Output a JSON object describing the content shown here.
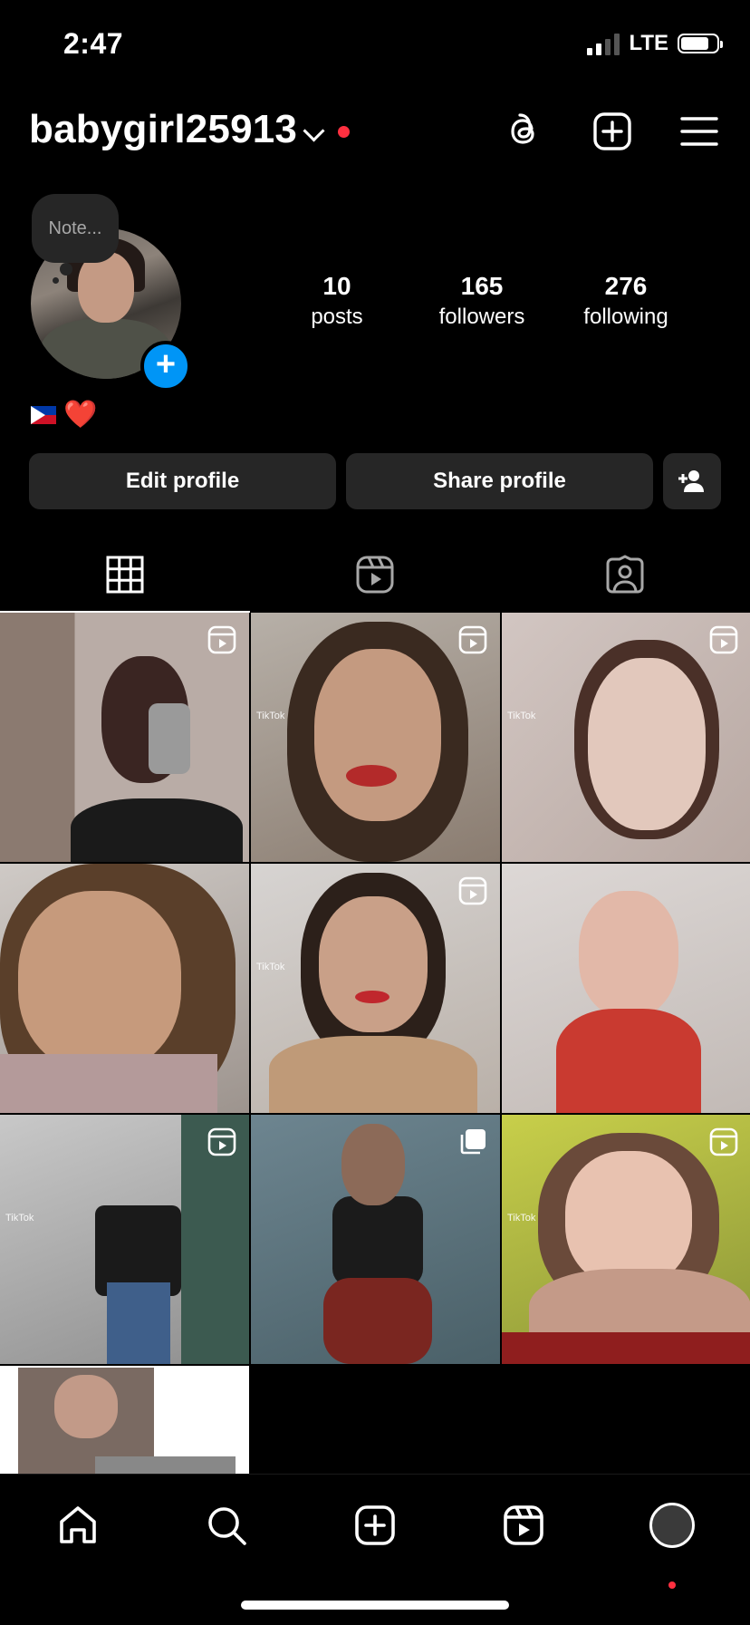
{
  "status_bar": {
    "time": "2:47",
    "network": "LTE"
  },
  "header": {
    "username": "babygirl25913",
    "icons": [
      "threads-icon",
      "create-icon",
      "menu-icon"
    ]
  },
  "profile": {
    "note_placeholder": "Note...",
    "stats": [
      {
        "number": "10",
        "label": "posts"
      },
      {
        "number": "165",
        "label": "followers"
      },
      {
        "number": "276",
        "label": "following"
      }
    ],
    "bio_emoji": [
      "philippines-flag",
      "red-heart"
    ],
    "bio_heart": "❤️",
    "buttons": {
      "edit": "Edit profile",
      "share": "Share profile"
    }
  },
  "tabs": [
    {
      "name": "grid",
      "icon": "grid-icon",
      "active": true
    },
    {
      "name": "reels",
      "icon": "reels-icon",
      "active": false
    },
    {
      "name": "tagged",
      "icon": "tagged-icon",
      "active": false
    }
  ],
  "posts": [
    {
      "type": "reel",
      "watermark": ""
    },
    {
      "type": "reel",
      "watermark": "TikTok"
    },
    {
      "type": "reel",
      "watermark": "TikTok"
    },
    {
      "type": "photo",
      "watermark": ""
    },
    {
      "type": "reel",
      "watermark": "TikTok"
    },
    {
      "type": "photo",
      "watermark": ""
    },
    {
      "type": "reel",
      "watermark": "TikTok"
    },
    {
      "type": "carousel",
      "watermark": ""
    },
    {
      "type": "reel",
      "watermark": "TikTok"
    },
    {
      "type": "photo",
      "watermark": ""
    }
  ],
  "bottom_nav": [
    "home-icon",
    "search-icon",
    "create-icon",
    "reels-icon",
    "profile-avatar"
  ],
  "colors": {
    "background": "#000000",
    "button": "#262626",
    "accent_blue": "#0095f6",
    "notification_red": "#ff3040"
  }
}
